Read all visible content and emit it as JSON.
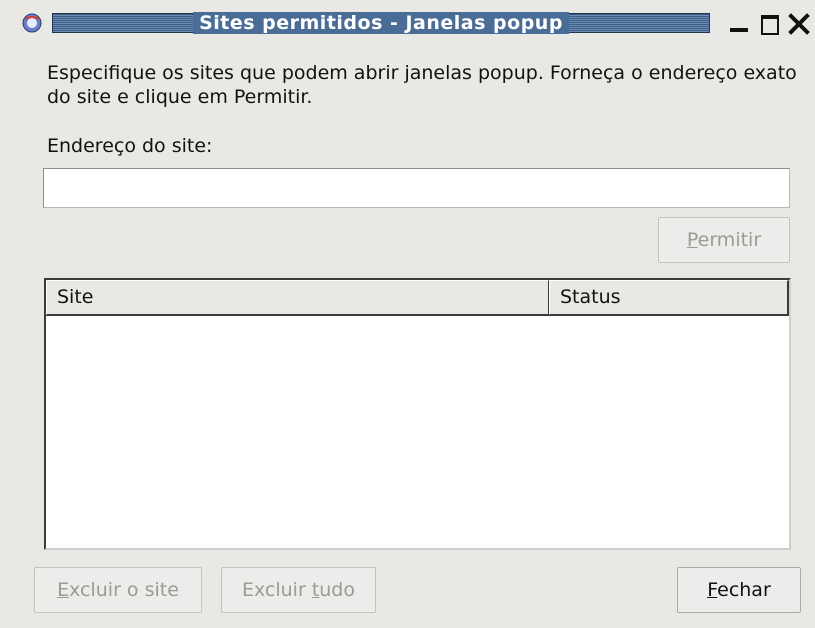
{
  "window": {
    "title": "Sites permitidos - Janelas popup",
    "icon": "browser-app-icon",
    "controls": [
      "minimize-icon",
      "maximize-icon",
      "close-icon"
    ]
  },
  "description": "Especifique os sites que podem abrir janelas popup. Forneça o endereço exato do site e clique em Permitir.",
  "address": {
    "label": "Endereço do site:",
    "value": "",
    "placeholder": ""
  },
  "buttons": {
    "allow": {
      "mnemonic": "P",
      "rest": "ermitir",
      "enabled": false
    },
    "remove_site": {
      "mnemonic": "E",
      "rest": "xcluir o site",
      "enabled": false
    },
    "remove_all": {
      "prefix": "Excluir ",
      "mnemonic": "t",
      "rest": "udo",
      "enabled": false
    },
    "close": {
      "mnemonic": "F",
      "rest": "echar",
      "enabled": true
    }
  },
  "table": {
    "columns": [
      "Site",
      "Status"
    ],
    "rows": []
  },
  "colors": {
    "titlebar_accent": "#4a6d97",
    "window_bg": "#e8e8e5",
    "disabled_text": "#9a9a96"
  }
}
